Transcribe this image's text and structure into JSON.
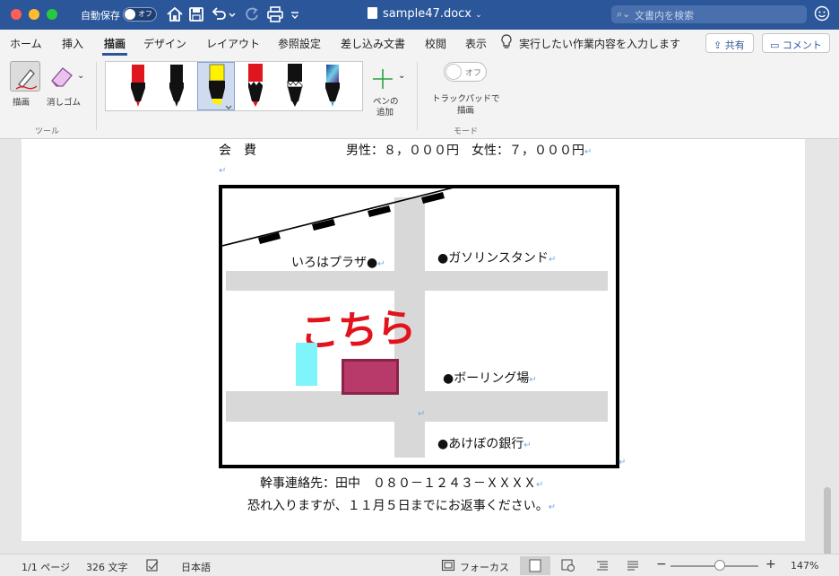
{
  "titlebar": {
    "autosave_label": "自動保存",
    "autosave_state": "オフ",
    "doc_title": "sample47.docx",
    "search_placeholder": "文書内を検索"
  },
  "tabs": [
    "ホーム",
    "挿入",
    "描画",
    "デザイン",
    "レイアウト",
    "参照設定",
    "差し込み文書",
    "校閲",
    "表示"
  ],
  "active_tab": "描画",
  "tell_me": "実行したい作業内容を入力します",
  "share_label": "共有",
  "comment_label": "コメント",
  "ribbon": {
    "draw_label": "描画",
    "eraser_label": "消しゴム",
    "tools_group": "ツール",
    "add_pen_label_1": "ペンの",
    "add_pen_label_2": "追加",
    "trackpad_label_1": "トラックパッドで",
    "trackpad_label_2": "描画",
    "trackpad_state": "オフ",
    "mode_group": "モード",
    "pens": [
      {
        "name": "red-pen",
        "color": "#e0161e"
      },
      {
        "name": "black-pen",
        "color": "#111111"
      },
      {
        "name": "yellow-highlighter",
        "color": "#fff200"
      },
      {
        "name": "red-marker",
        "color": "#e0161e"
      },
      {
        "name": "black-marker",
        "color": "#111111"
      },
      {
        "name": "galaxy-pen",
        "color": "#3a6fd8"
      }
    ]
  },
  "document": {
    "fee_label": "会　費",
    "fee_text": "男性：８，０００円　女性：７，０００円",
    "map": {
      "iroha": "いろはプラザ●",
      "gas": "●ガソリンスタンド",
      "kochira": "こちら",
      "bowling": "●ボーリング場",
      "bank": "●あけぼの銀行"
    },
    "contact": "幹事連絡先：田中　０８０－１２４３－ＸＸＸＸ",
    "reply": "恐れ入りますが、１１月５日までにお返事ください。"
  },
  "statusbar": {
    "pages": "1/1 ページ",
    "words": "326 文字",
    "language": "日本語",
    "focus": "フォーカス",
    "zoom": "147%"
  }
}
